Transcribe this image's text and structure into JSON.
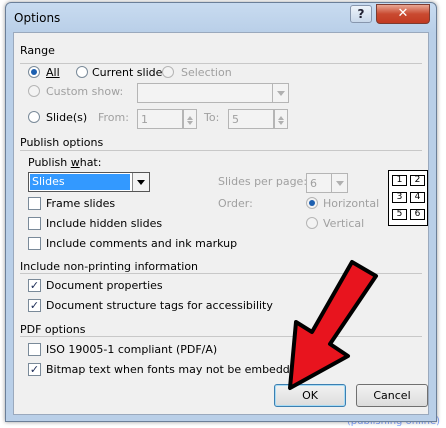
{
  "background": {
    "caption": "(publishing online)"
  },
  "window": {
    "title": "Options",
    "help_label": "?",
    "close_label": "✕"
  },
  "range": {
    "heading": "Range",
    "all_label": "All",
    "current_slide_label": "Current slide",
    "selection_label": "Selection",
    "custom_show_label": "Custom show:",
    "slides_label": "Slide(s)",
    "from_label": "From:",
    "from_value": "1",
    "to_label": "To:",
    "to_value": "5",
    "selected": "all"
  },
  "publish": {
    "heading": "Publish options",
    "what_label": "Publish what:",
    "what_value": "Slides",
    "frame_slides_label": "Frame slides",
    "hidden_slides_label": "Include hidden slides",
    "comments_label": "Include comments and ink markup",
    "slides_per_page_label": "Slides per page:",
    "slides_per_page_value": "6",
    "order_label": "Order:",
    "horizontal_label": "Horizontal",
    "vertical_label": "Vertical",
    "preview_numbers": [
      "1",
      "2",
      "3",
      "4",
      "5",
      "6"
    ]
  },
  "nonprinting": {
    "heading": "Include non-printing information",
    "doc_props_label": "Document properties",
    "doc_tags_label": "Document structure tags for accessibility",
    "doc_props_checked": true,
    "doc_tags_checked": true
  },
  "pdf": {
    "heading": "PDF options",
    "iso_label": "ISO 19005-1 compliant (PDF/A)",
    "bitmap_label": "Bitmap text when fonts may not be embedded",
    "iso_checked": false,
    "bitmap_checked": true
  },
  "buttons": {
    "ok_label": "OK",
    "cancel_label": "Cancel"
  },
  "colors": {
    "annotation_arrow": "#e8141e",
    "selection": "#3399ff"
  }
}
